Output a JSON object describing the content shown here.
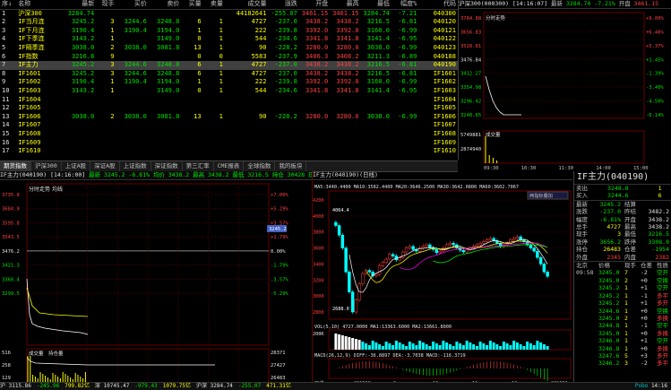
{
  "quote": {
    "headers": [
      "序↓",
      "名称",
      "最新",
      "现手",
      "买价",
      "卖价",
      "买量",
      "卖量",
      "成交量",
      "涨跌",
      "开盘",
      "最高",
      "最低",
      "幅度%",
      "代码"
    ],
    "rows": [
      [
        "1",
        "沪深300",
        "3284.74",
        "",
        "",
        "",
        "",
        "",
        "44182641",
        "-255.07",
        "3461.15",
        "3461.15",
        "3284.74",
        "-7.21",
        "040300"
      ],
      [
        "2",
        "IF当月连",
        "3245.2",
        "3",
        "3244.6",
        "3248.8",
        "6",
        "1",
        "4727",
        "-237.0",
        "3438.2",
        "3438.2",
        "3216.5",
        "-6.81",
        "040120"
      ],
      [
        "3",
        "IF下月连",
        "3190.4",
        "1",
        "3190.4",
        "3194.0",
        "1",
        "1",
        "222",
        "-239.8",
        "3392.0",
        "3392.0",
        "3160.0",
        "-6.99",
        "040121"
      ],
      [
        "4",
        "IF下季连",
        "3143.2",
        "1",
        "",
        "3149.0",
        "0",
        "1",
        "544",
        "-234.6",
        "3341.8",
        "3341.8",
        "3141.4",
        "-6.95",
        "040122"
      ],
      [
        "5",
        "IF隔季连",
        "3038.0",
        "2",
        "3038.0",
        "3081.8",
        "13",
        "1",
        "90",
        "-228.2",
        "3280.0",
        "3280.0",
        "3038.0",
        "-6.99",
        "040123"
      ],
      [
        "6",
        "IF指数",
        "3216.8",
        "9",
        "",
        "",
        "0",
        "0",
        "5583",
        "-237.9",
        "3406.3",
        "3408.2",
        "3211.3",
        "-6.89",
        "040188"
      ],
      [
        "7",
        "IF主力",
        "3245.2",
        "3",
        "3244.6",
        "3248.8",
        "6",
        "1",
        "4727",
        "-237.0",
        "3438.2",
        "3438.2",
        "3216.5",
        "-6.81",
        "040190"
      ],
      [
        "8",
        "IF1601",
        "3245.2",
        "3",
        "3244.6",
        "3248.8",
        "6",
        "1",
        "4727",
        "-237.0",
        "3438.2",
        "3438.2",
        "3216.5",
        "-6.81",
        "IF1601"
      ],
      [
        "9",
        "IF1602",
        "3190.4",
        "1",
        "3190.4",
        "3194.0",
        "1",
        "1",
        "222",
        "-239.8",
        "3392.0",
        "3392.0",
        "3160.0",
        "-6.99",
        "IF1602"
      ],
      [
        "10",
        "IF1603",
        "3143.2",
        "1",
        "",
        "3149.0",
        "0",
        "1",
        "544",
        "-234.6",
        "3341.8",
        "3341.8",
        "3141.4",
        "-6.95",
        "IF1603"
      ],
      [
        "11",
        "IF1604",
        "",
        "",
        "",
        "",
        "",
        "",
        "",
        "",
        "",
        "",
        "",
        "",
        "IF1604"
      ],
      [
        "12",
        "IF1605",
        "",
        "",
        "",
        "",
        "",
        "",
        "",
        "",
        "",
        "",
        "",
        "",
        "IF1605"
      ],
      [
        "13",
        "IF1606",
        "3038.0",
        "2",
        "3038.0",
        "3081.8",
        "13",
        "1",
        "90",
        "-228.2",
        "3280.0",
        "3280.0",
        "3038.0",
        "-6.99",
        "IF1606"
      ],
      [
        "14",
        "IF1607",
        "",
        "",
        "",
        "",
        "",
        "",
        "",
        "",
        "",
        "",
        "",
        "",
        "IF1607"
      ],
      [
        "15",
        "IF1608",
        "",
        "",
        "",
        "",
        "",
        "",
        "",
        "",
        "",
        "",
        "",
        "",
        "IF1608"
      ],
      [
        "16",
        "IF1609",
        "",
        "",
        "",
        "",
        "",
        "",
        "",
        "",
        "",
        "",
        "",
        "",
        "IF1609"
      ],
      [
        "17",
        "IF1610",
        "",
        "",
        "",
        "",
        "",
        "",
        "",
        "",
        "",
        "",
        "",
        "",
        "IF1610"
      ]
    ],
    "selected_index": 6
  },
  "mini": {
    "title": "沪深300(000300)",
    "time": "[14:16:07]",
    "latest_label": "最新",
    "latest": "3284.74",
    "change": "-7.21%",
    "open_label": "开盘",
    "open": "3461.15",
    "subtitle": "分时走势",
    "y_labels": [
      "3784.88",
      "3656.83",
      "3528.81",
      "3476.84",
      "3412.27",
      "3354.98",
      "3296.42",
      "3248.65"
    ],
    "y_pct": [
      "+9.00%",
      "+6.46%",
      "+5.37%",
      "+1.45%",
      "-1.39%",
      "-3.40%",
      "-4.50%",
      "-6.14%"
    ],
    "vol_label": "成交量",
    "vol_values": [
      "5749881",
      "2874940"
    ],
    "x_labels": [
      "09:30",
      "10:30",
      "11:30",
      "14:00",
      "15:00"
    ]
  },
  "tabs": [
    "期货指数",
    "沪深300",
    "上证A股",
    "深证A股",
    "上证指数",
    "深证指数",
    "第三汇率",
    "CME报表",
    "全球指数",
    "我的板块"
  ],
  "intraday": {
    "title": "IF主力(040190)",
    "time": "[14:16:00]",
    "info": "最新 3245.2  -6.81% 均价 3438.2 最高 3438.2 最低 3216.5 持仓 30428 现手 3",
    "subtitle": "分时走势",
    "subtitle2": "均线",
    "y_left": [
      "3735.8",
      "3684.9",
      "3595.8",
      "3543.5",
      "3476.2",
      "3421.3",
      "3360.4",
      "3299.5"
    ],
    "y_right": [
      "+7.00%",
      "+5.29%",
      "+3.57%",
      "+1.79%",
      "0.00%",
      "-1.79%",
      "-3.57%",
      "-5.29%"
    ],
    "cur_price_tag": "3245.2",
    "vol_label": "成交量",
    "vol_label2": "持仓量",
    "vol_left": [
      "516",
      "258",
      "129"
    ],
    "vol_right": [
      "28371",
      "27427",
      "26483"
    ],
    "x_labels": [
      "09:30",
      "10:00",
      "10:30",
      "11:00",
      "11:30",
      "13:30",
      "14:00",
      "14:30",
      "15:00"
    ]
  },
  "kline": {
    "title": "IF主力(040190)(日线)",
    "ma_line": "MA5:3440.4400 MA10:3582.4400 MA20:3646.2500 MA30:3642.0800 MA60:3602.7067",
    "ma_colors": {
      "k": "#ffffff",
      "ma5": "#ffffff",
      "ma10": "#ffff00",
      "ma20": "#ff00ff",
      "ma30": "#00ff00",
      "ma60": "#c0c0c0"
    },
    "y_labels": [
      "4200",
      "4000",
      "3800",
      "3600",
      "3400",
      "3200",
      "3000",
      "2800"
    ],
    "high_tag": "4064.4",
    "low_tag": "2688.0",
    "button": "两指标叠加",
    "vol_line": "VOL(5,10) 4727.0000  MA1:13363.6000  MA2:13661.8000",
    "vol_y": "200K",
    "macd_line": "MACD(26,12,9) DIFF:-36.8897 DEA:-3.7038 MACD:-116.3719",
    "x_labels": [
      "日线",
      "201508",
      "9",
      "10",
      "11",
      "12",
      "201601"
    ]
  },
  "side": {
    "name": "IF主力(040190)",
    "sell_label": "卖出",
    "sell_price": "3248.8",
    "sell_vol": "1",
    "buy_label": "买入",
    "buy_price": "3244.6",
    "buy_vol": "6",
    "stats": [
      [
        "最新",
        "3245.2",
        "结算",
        ""
      ],
      [
        "涨跌",
        "-237.0",
        "昨结",
        "3482.2"
      ],
      [
        "幅度",
        "-6.81%",
        "开盘",
        "3438.2"
      ],
      [
        "总手",
        "4727",
        "最高",
        "3438.2"
      ],
      [
        "现手",
        "3",
        "最低",
        "3216.5"
      ],
      [
        "涨停",
        "3656.2",
        "跌停",
        "3308.0"
      ],
      [
        "持仓",
        "26483",
        "仓差",
        "-1954"
      ],
      [
        "外盘",
        "2345",
        "内盘",
        "2382"
      ]
    ],
    "ticks_header": [
      "北京",
      "价格",
      "现手",
      "仓差",
      "性质"
    ],
    "ticks": [
      [
        "09:58",
        "3245.0",
        "7",
        "-2",
        "空开"
      ],
      [
        "",
        "3245.0",
        "2",
        "+0",
        "空换"
      ],
      [
        "",
        "3245.2",
        "1",
        "+1",
        "空开"
      ],
      [
        "",
        "3245.2",
        "1",
        "-1",
        "多平"
      ],
      [
        "",
        "3245.2",
        "1",
        "+1",
        "多开"
      ],
      [
        "",
        "3244.6",
        "1",
        "+0",
        "空换"
      ],
      [
        "",
        "3245.0",
        "2",
        "+0",
        "多换"
      ],
      [
        "",
        "3244.8",
        "1",
        "-1",
        "空平"
      ],
      [
        "",
        "3245.0",
        "1",
        "+0",
        "多换"
      ],
      [
        "",
        "3246.0",
        "1",
        "+1",
        "空开"
      ],
      [
        "",
        "3246.8",
        "1",
        "+0",
        "多换"
      ],
      [
        "",
        "3247.6",
        "5",
        "+3",
        "多开"
      ],
      [
        "",
        "3246.2",
        "3",
        "-2",
        "多平"
      ]
    ]
  },
  "status": {
    "items": [
      "沪 3115.86",
      "-245.96",
      "799.82亿",
      "深 10745.47",
      "-979.43",
      "1079.75亿",
      "沪深 3284.74",
      "-255.07",
      "471.31亿"
    ],
    "right": [
      "Pobo",
      "14:16"
    ]
  }
}
